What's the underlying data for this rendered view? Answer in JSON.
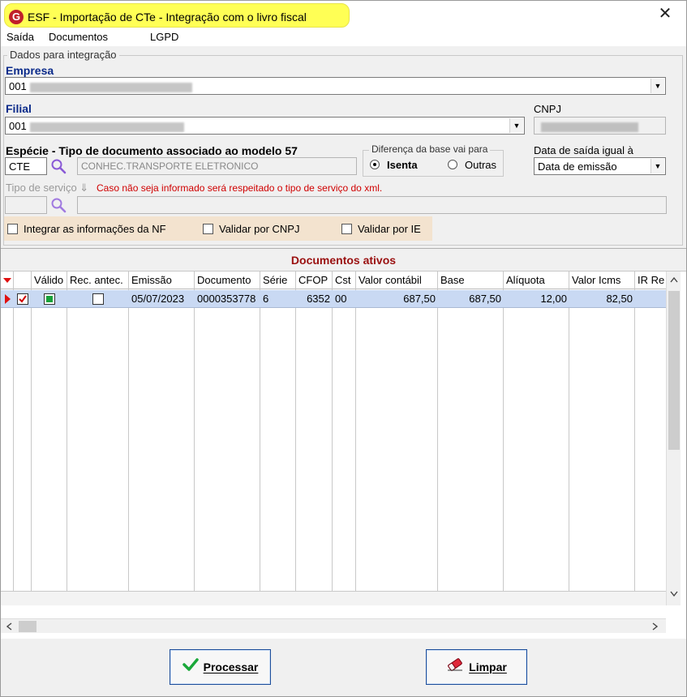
{
  "window": {
    "title": "ESF - Importação de CTe - Integração com o livro fiscal",
    "logo_letter": "G",
    "close_glyph": "✕"
  },
  "menu": [
    "Saída",
    "Documentos",
    "LGPD"
  ],
  "integration_group": {
    "legend": "Dados para integração",
    "empresa": {
      "label": "Empresa",
      "value": "001"
    },
    "filial": {
      "label": "Filial",
      "value": "001"
    },
    "cnpj": {
      "label": "CNPJ"
    },
    "especie": {
      "label": "Espécie - Tipo de documento associado ao modelo 57",
      "code": "CTE",
      "description": "CONHEC.TRANSPORTE ELETRONICO"
    },
    "diferenca": {
      "legend": "Diferença da base vai para",
      "options": [
        "Isenta",
        "Outras"
      ],
      "selected": "Isenta"
    },
    "data_saida": {
      "label": "Data de saída igual à",
      "value": "Data de emissão"
    },
    "tipo_servico": {
      "label": "Tipo de serviço",
      "arrow": "⇓",
      "hint": "Caso não seja informado será respeitado o tipo de serviço do xml."
    },
    "checkboxes": [
      {
        "label": "Integrar as informações da NF",
        "checked": false
      },
      {
        "label": "Validar por CNPJ",
        "checked": false
      },
      {
        "label": "Validar por IE",
        "checked": false
      }
    ]
  },
  "grid": {
    "caption": "Documentos ativos",
    "columns": [
      "",
      "Válido",
      "Rec. antec.",
      "Emissão",
      "Documento",
      "Série",
      "CFOP",
      "Cst",
      "Valor contábil",
      "Base",
      "Alíquota",
      "Valor Icms",
      "IR Re"
    ],
    "rows": [
      {
        "selected": true,
        "valido": true,
        "rec_antec": false,
        "emissao": "05/07/2023",
        "documento": "0000353778",
        "serie": "6",
        "cfop": "6352",
        "cst": "00",
        "valor_contabil": "687,50",
        "base": "687,50",
        "aliquota": "12,00",
        "valor_icms": "82,50"
      }
    ]
  },
  "buttons": {
    "processar": "Processar",
    "limpar": "Limpar"
  },
  "colors": {
    "title_highlight": "#ffff55",
    "selected_row": "#c9d9f3",
    "caption_red": "#9a1010",
    "checkbox_area": "#f3e3cf"
  }
}
